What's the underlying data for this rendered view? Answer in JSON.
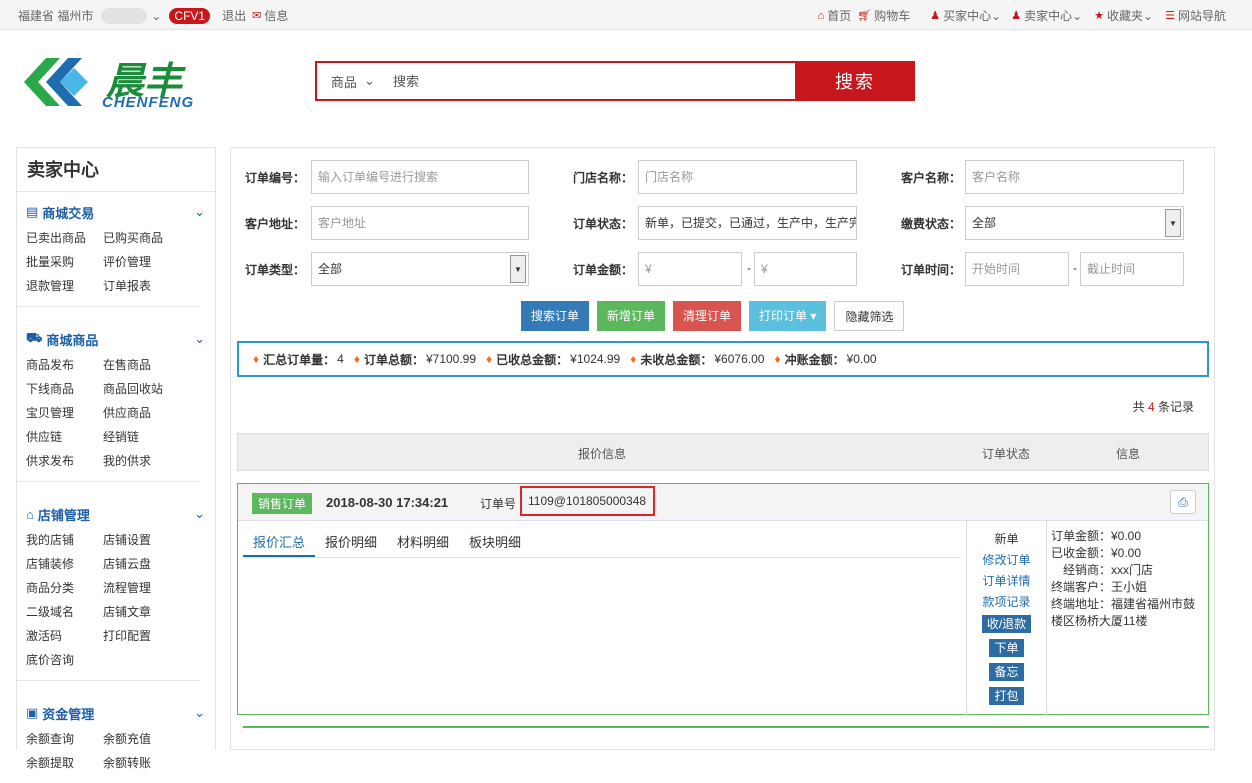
{
  "topbar": {
    "location": "福建省 福州市",
    "cfv": "CFV1",
    "logout": "退出",
    "messages": "信息",
    "home": "首页",
    "cart": "购物车",
    "buyer_center": "买家中心",
    "seller_center": "卖家中心",
    "favorites": "收藏夹",
    "site_nav": "网站导航"
  },
  "logo": {
    "cn": "晨丰",
    "en": "CHENFENG"
  },
  "search": {
    "category": "商品",
    "placeholder": "搜索",
    "button": "搜索"
  },
  "sidebar": {
    "title": "卖家中心",
    "groups": [
      {
        "title": "商城交易",
        "items": [
          "已卖出商品",
          "已购买商品",
          "批量采购",
          "评价管理",
          "退款管理",
          "订单报表"
        ]
      },
      {
        "title": "商城商品",
        "items": [
          "商品发布",
          "在售商品",
          "下线商品",
          "商品回收站",
          "宝贝管理",
          "供应商品",
          "供应链",
          "经销链",
          "供求发布",
          "我的供求"
        ]
      },
      {
        "title": "店铺管理",
        "items": [
          "我的店铺",
          "店铺设置",
          "店铺装修",
          "店铺云盘",
          "商品分类",
          "流程管理",
          "二级域名",
          "店铺文章",
          "激活码",
          "打印配置",
          "底价咨询"
        ]
      },
      {
        "title": "资金管理",
        "items": [
          "余额查询",
          "余额充值",
          "余额提取",
          "余额转账"
        ]
      }
    ]
  },
  "filters": {
    "order_no_label": "订单编号：",
    "order_no_ph": "输入订单编号进行搜索",
    "store_label": "门店名称：",
    "store_ph": "门店名称",
    "customer_label": "客户名称：",
    "customer_ph": "客户名称",
    "address_label": "客户地址：",
    "address_ph": "客户地址",
    "status_label": "订单状态：",
    "status_value": "新单，已提交，已通过，生产中，生产完成",
    "fee_label": "缴费状态：",
    "fee_value": "全部",
    "type_label": "订单类型：",
    "type_value": "全部",
    "amount_label": "订单金额：",
    "amount_min_ph": "¥",
    "amount_max_ph": "¥",
    "dash": "-",
    "time_label": "订单时间：",
    "time_start_ph": "开始时间",
    "time_end_ph": "截止时间"
  },
  "actions": {
    "search": "搜索订单",
    "add": "新增订单",
    "clear": "清理订单",
    "print": "打印订单",
    "hide": "隐藏筛选"
  },
  "summary": {
    "count_label": "汇总订单量：",
    "count": "4",
    "total_label": "订单总额：",
    "total": "¥7100.99",
    "received_label": "已收总金额：",
    "received": "¥1024.99",
    "unreceived_label": "未收总金额：",
    "unreceived": "¥6076.00",
    "offset_label": "冲账金额：",
    "offset": "¥0.00"
  },
  "records": {
    "prefix": "共",
    "count": "4",
    "suffix": "条记录"
  },
  "table": {
    "col_quote": "报价信息",
    "col_status": "订单状态",
    "col_info": "信息"
  },
  "order": {
    "tag": "销售订单",
    "datetime": "2018-08-30 17:34:21",
    "no_label": "订单号",
    "no": "1109@101805000348",
    "tabs": [
      "报价汇总",
      "报价明细",
      "材料明细",
      "板块明细"
    ],
    "status": "新单",
    "links": [
      "修改订单",
      "订单详情",
      "款项记录"
    ],
    "buttons": [
      "收/退款",
      "下单",
      "备忘",
      "打包"
    ],
    "info": [
      "订单金额：¥0.00",
      "已收金额：¥0.00",
      "经销商：xxx门店",
      "终端客户：王小姐",
      "终端地址：福建省福州市鼓楼区杨桥大厦11楼"
    ]
  }
}
